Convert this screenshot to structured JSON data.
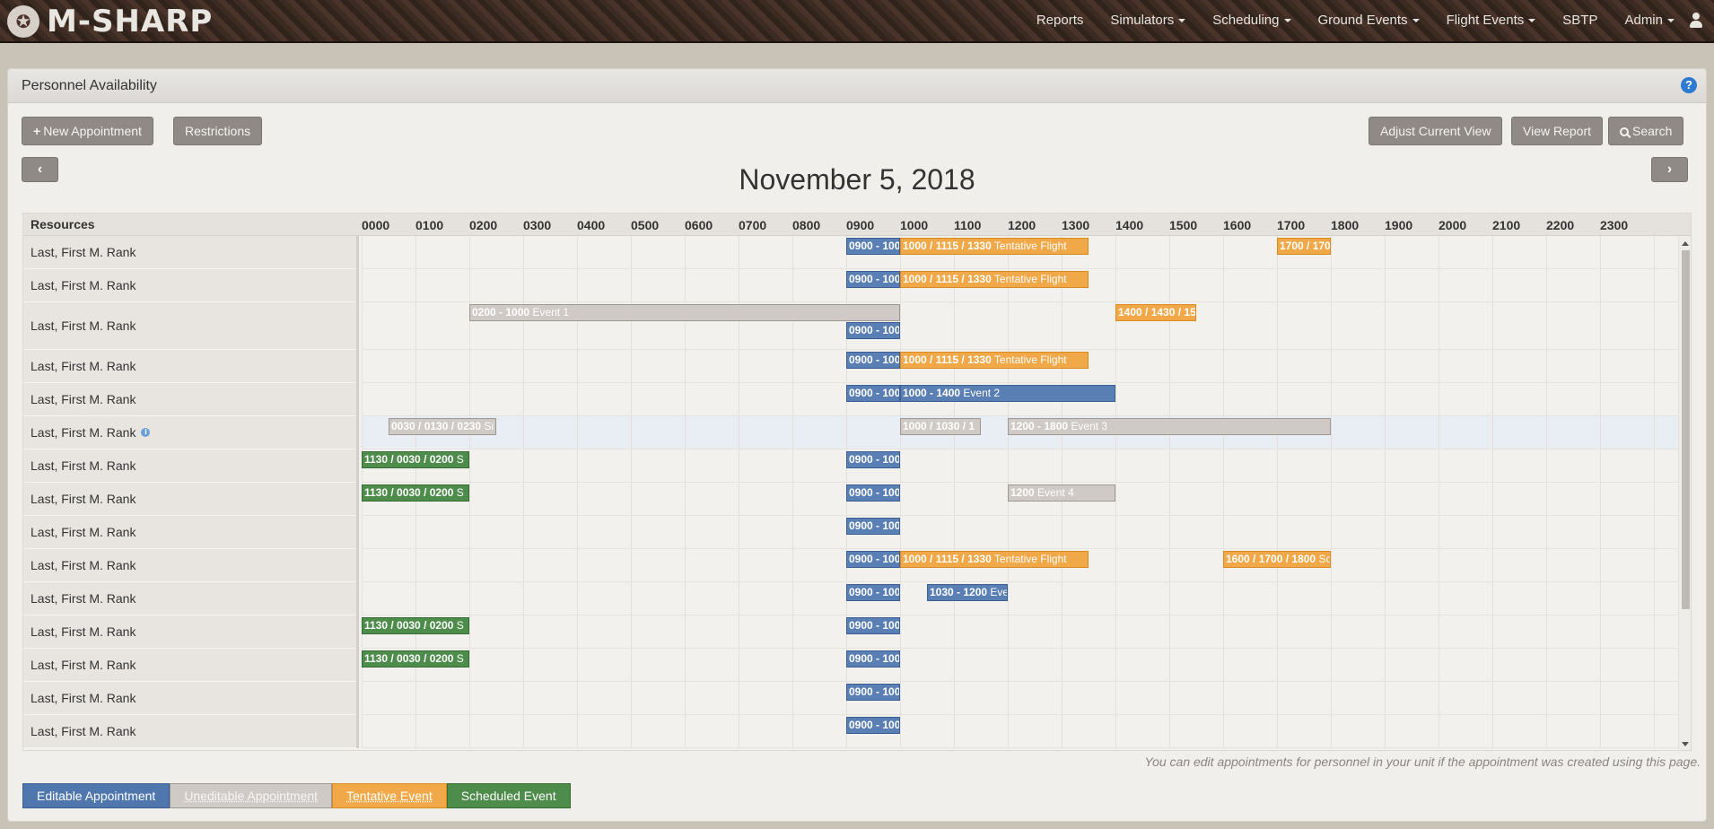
{
  "app": {
    "brand": "M-SHARP",
    "emblem": "eagle-globe-anchor-emblem"
  },
  "nav": [
    {
      "label": "Reports",
      "dropdown": false
    },
    {
      "label": "Simulators",
      "dropdown": true
    },
    {
      "label": "Scheduling",
      "dropdown": true
    },
    {
      "label": "Ground Events",
      "dropdown": true
    },
    {
      "label": "Flight Events",
      "dropdown": true
    },
    {
      "label": "SBTP",
      "dropdown": false
    },
    {
      "label": "Admin",
      "dropdown": true
    }
  ],
  "panel": {
    "title": "Personnel Availability",
    "help_icon": "?"
  },
  "toolbar": {
    "new_appointment": "New Appointment",
    "restrictions": "Restrictions",
    "adjust_view": "Adjust Current View",
    "view_report": "View Report",
    "search": "Search"
  },
  "date_title": "November 5, 2018",
  "nav_arrows": {
    "prev": "‹",
    "next": "›"
  },
  "grid": {
    "resources_header": "Resources",
    "hours": [
      "0000",
      "0100",
      "0200",
      "0300",
      "0400",
      "0500",
      "0600",
      "0700",
      "0800",
      "0900",
      "1000",
      "1100",
      "1200",
      "1300",
      "1400",
      "1500",
      "1600",
      "1700",
      "1800",
      "1900",
      "2000",
      "2100",
      "2200",
      "2300"
    ],
    "rows": [
      {
        "name": "Last, First M. Rank",
        "info": false,
        "highlight": false,
        "tall": false,
        "events": [
          {
            "color": "blue",
            "time": "0900 - 100",
            "text": "",
            "start": 9.0,
            "end": 10.0,
            "line": 0
          },
          {
            "color": "orange",
            "time": "1000 / 1115 / 1330",
            "text": "Tentative Flight",
            "start": 10.0,
            "end": 13.5,
            "line": 0
          },
          {
            "color": "orange",
            "time": "1700 / 170",
            "text": "",
            "start": 17.0,
            "end": 18.0,
            "line": 0
          }
        ]
      },
      {
        "name": "Last, First M. Rank",
        "info": false,
        "highlight": false,
        "tall": false,
        "events": [
          {
            "color": "blue",
            "time": "0900 - 100",
            "text": "",
            "start": 9.0,
            "end": 10.0,
            "line": 0
          },
          {
            "color": "orange",
            "time": "1000 / 1115 / 1330",
            "text": "Tentative Flight",
            "start": 10.0,
            "end": 13.5,
            "line": 0
          }
        ]
      },
      {
        "name": "Last, First M. Rank",
        "info": false,
        "highlight": false,
        "tall": true,
        "events": [
          {
            "color": "gray",
            "time": "0200 - 1000",
            "text": "Event 1",
            "start": 2.0,
            "end": 10.0,
            "line": 0
          },
          {
            "color": "orange",
            "time": "1400 / 1430 / 15",
            "text": "",
            "start": 14.0,
            "end": 15.5,
            "line": 0
          },
          {
            "color": "blue",
            "time": "0900 - 100",
            "text": "",
            "start": 9.0,
            "end": 10.0,
            "line": 1
          }
        ]
      },
      {
        "name": "Last, First M. Rank",
        "info": false,
        "highlight": false,
        "tall": false,
        "events": [
          {
            "color": "blue",
            "time": "0900 - 100",
            "text": "",
            "start": 9.0,
            "end": 10.0,
            "line": 0
          },
          {
            "color": "orange",
            "time": "1000 / 1115 / 1330",
            "text": "Tentative Flight",
            "start": 10.0,
            "end": 13.5,
            "line": 0
          }
        ]
      },
      {
        "name": "Last, First M. Rank",
        "info": false,
        "highlight": false,
        "tall": false,
        "events": [
          {
            "color": "blue",
            "time": "0900 - 100",
            "text": "",
            "start": 9.0,
            "end": 10.0,
            "line": 0
          },
          {
            "color": "blue",
            "time": "1000 - 1400",
            "text": "Event 2",
            "start": 10.0,
            "end": 14.0,
            "line": 0
          }
        ]
      },
      {
        "name": "Last, First M. Rank",
        "info": true,
        "highlight": true,
        "tall": false,
        "events": [
          {
            "color": "gray",
            "time": "0030 / 0130 / 0230",
            "text": "Si",
            "start": 0.5,
            "end": 2.5,
            "line": 0
          },
          {
            "color": "gray",
            "time": "1000 / 1030 / 1",
            "text": "",
            "start": 10.0,
            "end": 11.5,
            "line": 0
          },
          {
            "color": "gray",
            "time": "1200 - 1800",
            "text": "Event 3",
            "start": 12.0,
            "end": 18.0,
            "line": 0
          }
        ]
      },
      {
        "name": "Last, First M. Rank",
        "info": false,
        "highlight": false,
        "tall": false,
        "events": [
          {
            "color": "green",
            "time": "1130 / 0030 / 0200",
            "text": "S",
            "start": 0.0,
            "end": 2.0,
            "line": 0
          },
          {
            "color": "blue",
            "time": "0900 - 100",
            "text": "",
            "start": 9.0,
            "end": 10.0,
            "line": 0
          }
        ]
      },
      {
        "name": "Last, First M. Rank",
        "info": false,
        "highlight": false,
        "tall": false,
        "events": [
          {
            "color": "green",
            "time": "1130 / 0030 / 0200",
            "text": "S",
            "start": 0.0,
            "end": 2.0,
            "line": 0
          },
          {
            "color": "blue",
            "time": "0900 - 100",
            "text": "",
            "start": 9.0,
            "end": 10.0,
            "line": 0
          },
          {
            "color": "gray",
            "time": "1200",
            "text": "Event 4",
            "start": 12.0,
            "end": 14.0,
            "line": 0
          }
        ]
      },
      {
        "name": "Last, First M. Rank",
        "info": false,
        "highlight": false,
        "tall": false,
        "events": [
          {
            "color": "blue",
            "time": "0900 - 100",
            "text": "",
            "start": 9.0,
            "end": 10.0,
            "line": 0
          }
        ]
      },
      {
        "name": "Last, First M. Rank",
        "info": false,
        "highlight": false,
        "tall": false,
        "events": [
          {
            "color": "blue",
            "time": "0900 - 100",
            "text": "",
            "start": 9.0,
            "end": 10.0,
            "line": 0
          },
          {
            "color": "orange",
            "time": "1000 / 1115 / 1330",
            "text": "Tentative Flight",
            "start": 10.0,
            "end": 13.5,
            "line": 0
          },
          {
            "color": "orange",
            "time": "1600 / 1700 / 1800",
            "text": "Sc",
            "start": 16.0,
            "end": 18.0,
            "line": 0
          }
        ]
      },
      {
        "name": "Last, First M. Rank",
        "info": false,
        "highlight": false,
        "tall": false,
        "events": [
          {
            "color": "blue",
            "time": "0900 - 100",
            "text": "",
            "start": 9.0,
            "end": 10.0,
            "line": 0
          },
          {
            "color": "blue",
            "time": "1030 - 1200",
            "text": "Eve",
            "start": 10.5,
            "end": 12.0,
            "line": 0
          }
        ]
      },
      {
        "name": "Last, First M. Rank",
        "info": false,
        "highlight": false,
        "tall": false,
        "events": [
          {
            "color": "green",
            "time": "1130 / 0030 / 0200",
            "text": "S",
            "start": 0.0,
            "end": 2.0,
            "line": 0
          },
          {
            "color": "blue",
            "time": "0900 - 100",
            "text": "",
            "start": 9.0,
            "end": 10.0,
            "line": 0
          }
        ]
      },
      {
        "name": "Last, First M. Rank",
        "info": false,
        "highlight": false,
        "tall": false,
        "events": [
          {
            "color": "green",
            "time": "1130 / 0030 / 0200",
            "text": "S",
            "start": 0.0,
            "end": 2.0,
            "line": 0
          },
          {
            "color": "blue",
            "time": "0900 - 100",
            "text": "",
            "start": 9.0,
            "end": 10.0,
            "line": 0
          }
        ]
      },
      {
        "name": "Last, First M. Rank",
        "info": false,
        "highlight": false,
        "tall": false,
        "events": [
          {
            "color": "blue",
            "time": "0900 - 100",
            "text": "",
            "start": 9.0,
            "end": 10.0,
            "line": 0
          }
        ]
      },
      {
        "name": "Last, First M. Rank",
        "info": false,
        "highlight": false,
        "tall": false,
        "events": [
          {
            "color": "blue",
            "time": "0900 - 100",
            "text": "",
            "start": 9.0,
            "end": 10.0,
            "line": 0
          }
        ]
      }
    ]
  },
  "note": "You can edit appointments for personnel in your unit if the appointment was created using this page.",
  "legend": [
    {
      "label": "Editable Appointment",
      "color": "blue"
    },
    {
      "label": "Uneditable Appointment",
      "color": "gray"
    },
    {
      "label": "Tentative Event",
      "color": "orange"
    },
    {
      "label": "Scheduled Event",
      "color": "green"
    }
  ],
  "colors": {
    "editable": "#4f77ae",
    "uneditable": "#cfcac6",
    "tentative": "#f0a848",
    "scheduled": "#4e8c4c",
    "help": "#2c7bd0"
  }
}
